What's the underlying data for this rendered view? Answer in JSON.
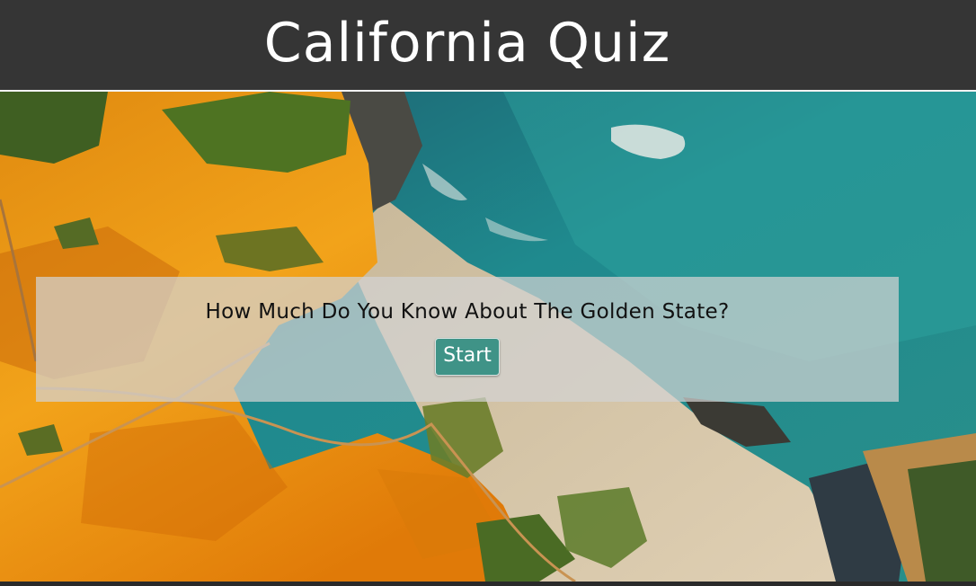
{
  "header": {
    "title": "California Quiz"
  },
  "hero": {
    "image": "coastline-aerial-photo"
  },
  "quiz": {
    "question": "How Much Do You Know About The Golden State?",
    "start_label": "Start"
  },
  "colors": {
    "header_bg": "#353535",
    "button_bg": "#3f9387",
    "panel_bg": "rgba(210,210,210,0.72)"
  }
}
